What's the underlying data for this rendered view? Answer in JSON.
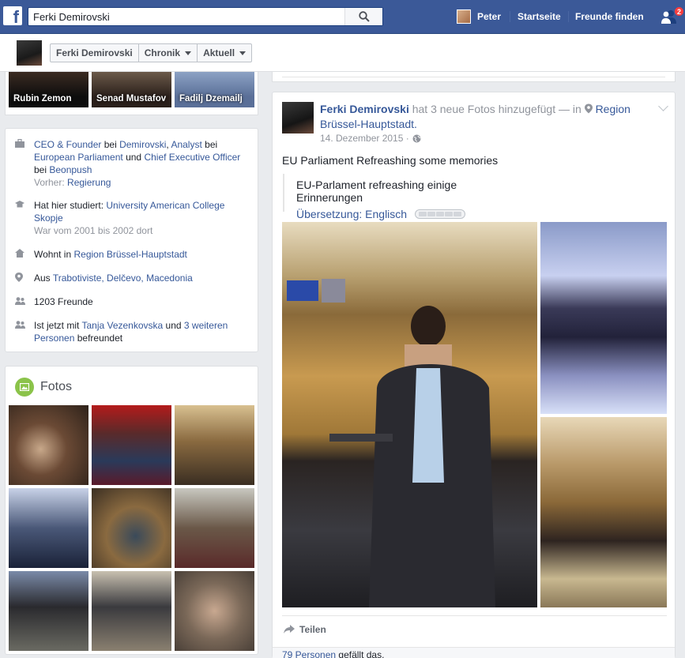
{
  "topbar": {
    "search_value": "Ferki Demirovski",
    "user_name": "Peter",
    "nav_home": "Startseite",
    "nav_find_friends": "Freunde finden",
    "friend_requests_count": "2"
  },
  "profile_nav": {
    "name": "Ferki Demirovski",
    "timeline": "Chronik",
    "recent": "Aktuell"
  },
  "friends_strip": [
    {
      "name": "Rubin Zemon"
    },
    {
      "name": "Senad Mustafov"
    },
    {
      "name": "Fadilj Dzemailj"
    }
  ],
  "intro": {
    "work_1": "CEO & Founder",
    "work_at_1": "bei",
    "work_company_1": "Demirovski",
    "work_2": "Analyst",
    "work_at_2": "bei",
    "work_company_2": "European Parliament",
    "work_and": "und",
    "work_3": "Chief Executive Officer",
    "work_at_3": "bei",
    "work_company_3": "Beonpush",
    "prev_label": "Vorher:",
    "prev_value": "Regierung",
    "edu_prefix": "Hat hier studiert:",
    "edu_school": "University American College Skopje",
    "edu_years": "War vom 2001 bis 2002 dort",
    "lives_prefix": "Wohnt in",
    "lives_place": "Region Brüssel-Hauptstadt",
    "from_prefix": "Aus",
    "from_place": "Trabotiviste, Delčevo, Macedonia",
    "friends_count": "1203 Freunde",
    "now_prefix": "Ist jetzt mit",
    "now_person": "Tanja Vezenkovska",
    "now_and": "und",
    "now_others": "3 weiteren Personen",
    "now_suffix": "befreundet"
  },
  "fotos": {
    "title": "Fotos"
  },
  "post": {
    "author": "Ferki Demirovski",
    "action": "hat 3 neue Fotos hinzugefügt — in",
    "place": "Region Brüssel-Hauptstadt.",
    "date": "14. Dezember 2015 ·",
    "text": "EU Parliament Refreashing some memories",
    "translation": "EU-Parlament refreashing einige Erinnerungen",
    "translation_link": "Übersetzung: Englisch",
    "share_label": "Teilen",
    "likes_link": "79 Personen",
    "likes_suffix": "gefällt das."
  },
  "colors": {
    "brand": "#3b5998",
    "link": "#365899",
    "page_bg": "#e9ebee",
    "badge": "#fa3e3e",
    "fotos_icon": "#8bc34a"
  },
  "icons": {
    "search": "search-icon",
    "friends": "friend-requests-icon",
    "work": "briefcase-icon",
    "education": "graduation-cap-icon",
    "home": "home-icon",
    "location": "map-pin-icon",
    "people": "people-icon",
    "globe": "globe-icon",
    "share": "share-arrow-icon",
    "photos": "photos-icon"
  }
}
